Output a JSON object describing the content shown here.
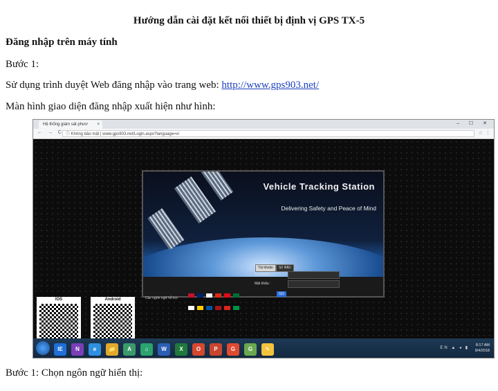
{
  "document": {
    "title": "Hướng dẫn cài đặt kết nối thiết bị định vị GPS TX-5",
    "section_heading": "Đăng nhập trên máy tính",
    "step1_label": "Bước 1:",
    "instruction_text": "Sử dụng trình duyệt Web đăng nhập vào trang web: ",
    "instruction_link": "http://www.gps903.net/",
    "screen_caption": "Màn hình giao diện đăng nhập xuất hiện như hình:",
    "step1b_label": "Bước 1: Chọn ngôn ngữ hiển thị:"
  },
  "browser": {
    "tab_title": "Hệ thống giám sát phươ",
    "tab_close": "×",
    "nav_buttons": "← → C",
    "security_label": "Không bảo mật",
    "url": "www.gps903.net/Login.aspx?language=vi",
    "star_icon": "☆",
    "menu_icon": "⋮",
    "window_controls": "– ☐ ✕"
  },
  "site": {
    "brand": "Vehicle Tracking Station",
    "tagline": "Delivering Safety and Peace of Mind",
    "login_tabs": [
      "Tài khoản",
      "Số IMEI"
    ],
    "account_label": "Tài khoản :",
    "password_label": "Mật khẩu :",
    "go_label": "GO",
    "language_label": "Các ngôn ngữ hỗ trợ:",
    "flag_colors": [
      "#c8102e",
      "#012169",
      "#ffffff",
      "#de2910",
      "#e30a17",
      "#006c35",
      "#ffffff",
      "#ffce00",
      "#0055a4",
      "#aa151b",
      "#da251d",
      "#009246"
    ]
  },
  "qr": {
    "ios_label": "IOS",
    "android_label": "Android"
  },
  "taskbar": {
    "icons": [
      "IE",
      "N",
      "e",
      "📁",
      "A",
      "⌂",
      "W",
      "X",
      "O",
      "P",
      "G",
      "G",
      "✎"
    ],
    "tray": "EN ▲ ◂ ▮",
    "time": "8:17 AM",
    "date": "9/4/2018"
  }
}
